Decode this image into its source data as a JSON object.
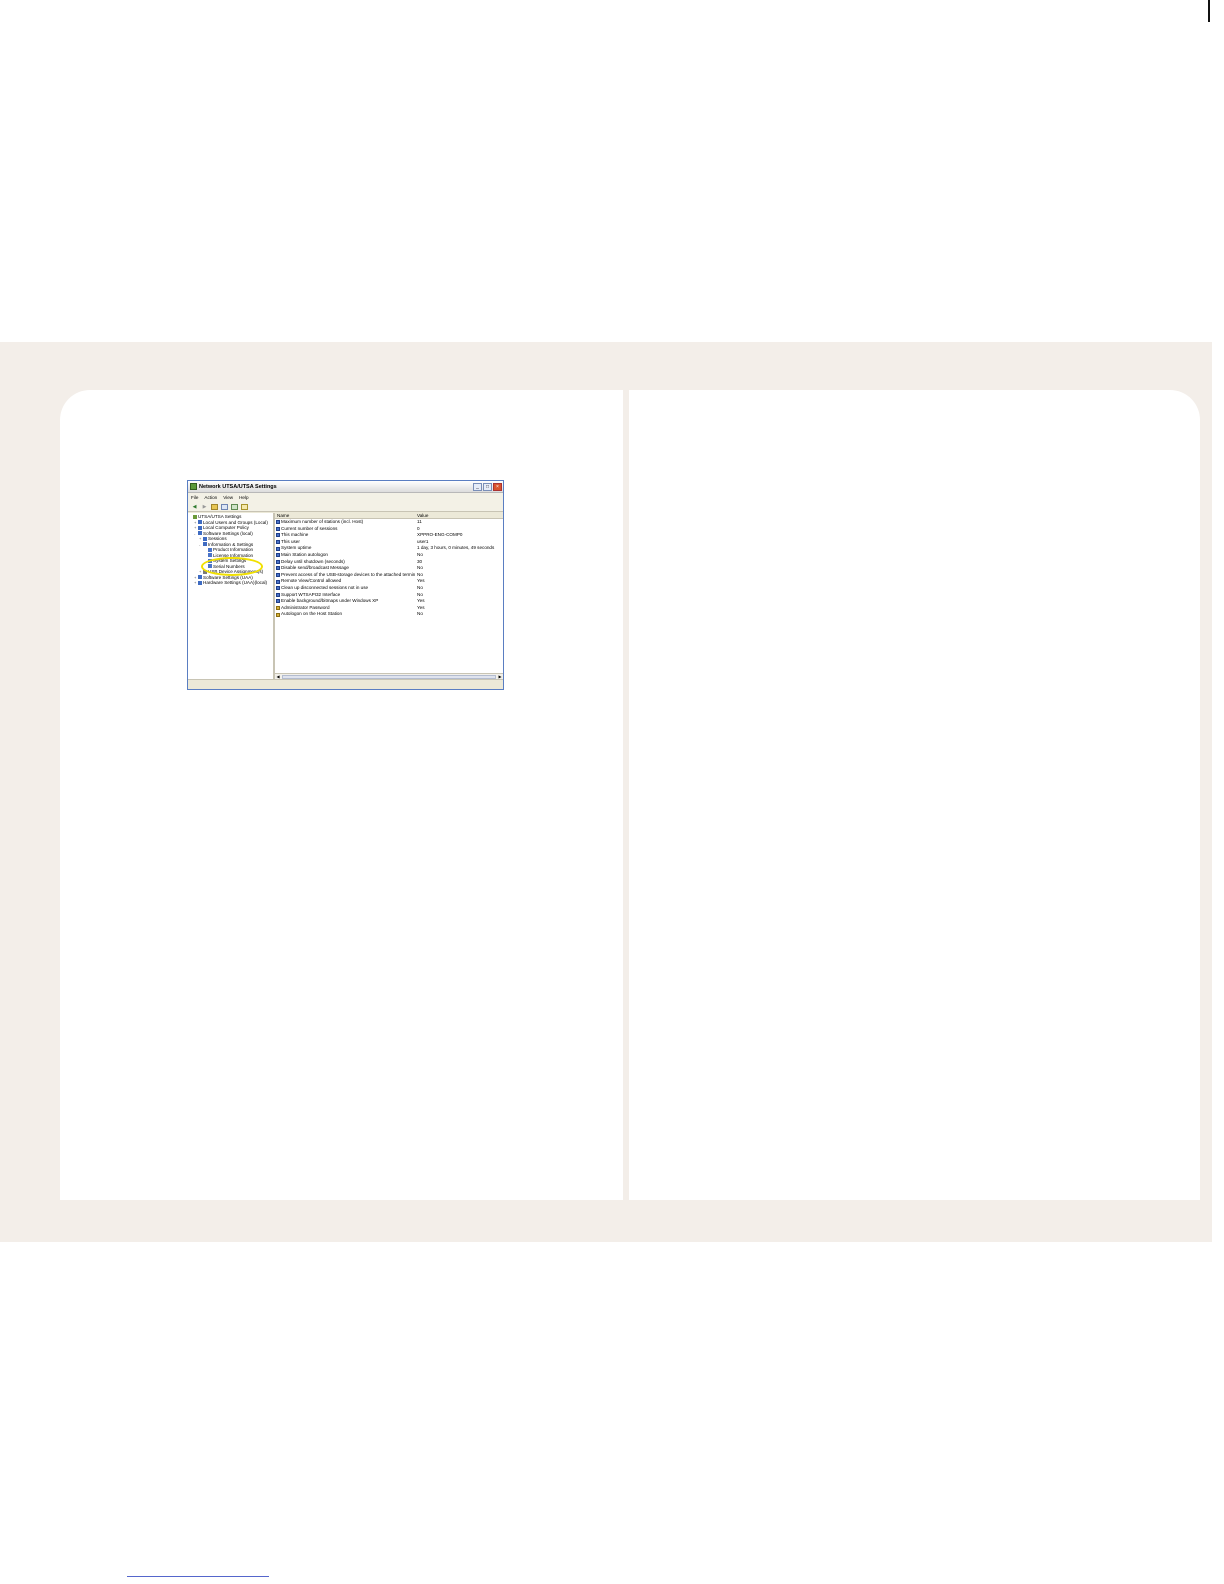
{
  "window": {
    "title": "Network UTSA/UTSA Settings",
    "menu": [
      "File",
      "Action",
      "View",
      "Help"
    ],
    "toolbar_icons": [
      "back-arrow-icon",
      "forward-arrow-icon",
      "up-folder-icon",
      "show-hide-tree-icon",
      "export-list-icon",
      "help-icon"
    ],
    "tree": [
      {
        "label": "UTSA/UTSA Settings",
        "indent": 0,
        "expander": ""
      },
      {
        "label": "Local Users and Groups (Local)",
        "indent": 1,
        "expander": "+"
      },
      {
        "label": "Local Computer Policy",
        "indent": 1,
        "expander": "+"
      },
      {
        "label": "Software Settings (local)",
        "indent": 1,
        "expander": "-"
      },
      {
        "label": "Sessions",
        "indent": 2,
        "expander": "+"
      },
      {
        "label": "Information & Settings",
        "indent": 2,
        "expander": "-"
      },
      {
        "label": "Product Information",
        "indent": 3,
        "expander": ""
      },
      {
        "label": "License Information",
        "indent": 3,
        "expander": ""
      },
      {
        "label": "System Settings",
        "indent": 3,
        "expander": ""
      },
      {
        "label": "Serial Numbers",
        "indent": 3,
        "expander": ""
      },
      {
        "label": "USB Device Assignment(s)",
        "indent": 2,
        "expander": "+"
      },
      {
        "label": "Software Settings (UAA)",
        "indent": 1,
        "expander": "+"
      },
      {
        "label": "Hardware Settings (UAA)(local)",
        "indent": 1,
        "expander": "+"
      }
    ],
    "list": {
      "headers": {
        "name": "Name",
        "value": "Value"
      },
      "rows": [
        {
          "name": "Maximum number of stations (incl. Host)",
          "value": "11"
        },
        {
          "name": "Current number of sessions",
          "value": "0"
        },
        {
          "name": "This machine",
          "value": "XPPRO-ENG-COMP0"
        },
        {
          "name": "This user",
          "value": "user1"
        },
        {
          "name": "System uptime",
          "value": "1 day, 3 hours, 0 minutes, 49 seconds"
        },
        {
          "name": "Main Station autologon",
          "value": "No"
        },
        {
          "name": "Delay until shutdown (seconds)",
          "value": "30"
        },
        {
          "name": "Disable send/broadcast Message",
          "value": "No"
        },
        {
          "name": "Prevent access of the USB-storage devices to the attached terminal...",
          "value": "No"
        },
        {
          "name": "Remote View/Control allowed",
          "value": "Yes"
        },
        {
          "name": "Clean up disconnected sessions not in use",
          "value": "No"
        },
        {
          "name": "Support WTSAPI32 Interface",
          "value": "No"
        },
        {
          "name": "Enable background/bitmaps under Windows XP",
          "value": "Yes"
        },
        {
          "name": "Administrator Password",
          "value": "Yes"
        },
        {
          "name": "Autologon on the Host Station",
          "value": "No"
        }
      ]
    }
  }
}
